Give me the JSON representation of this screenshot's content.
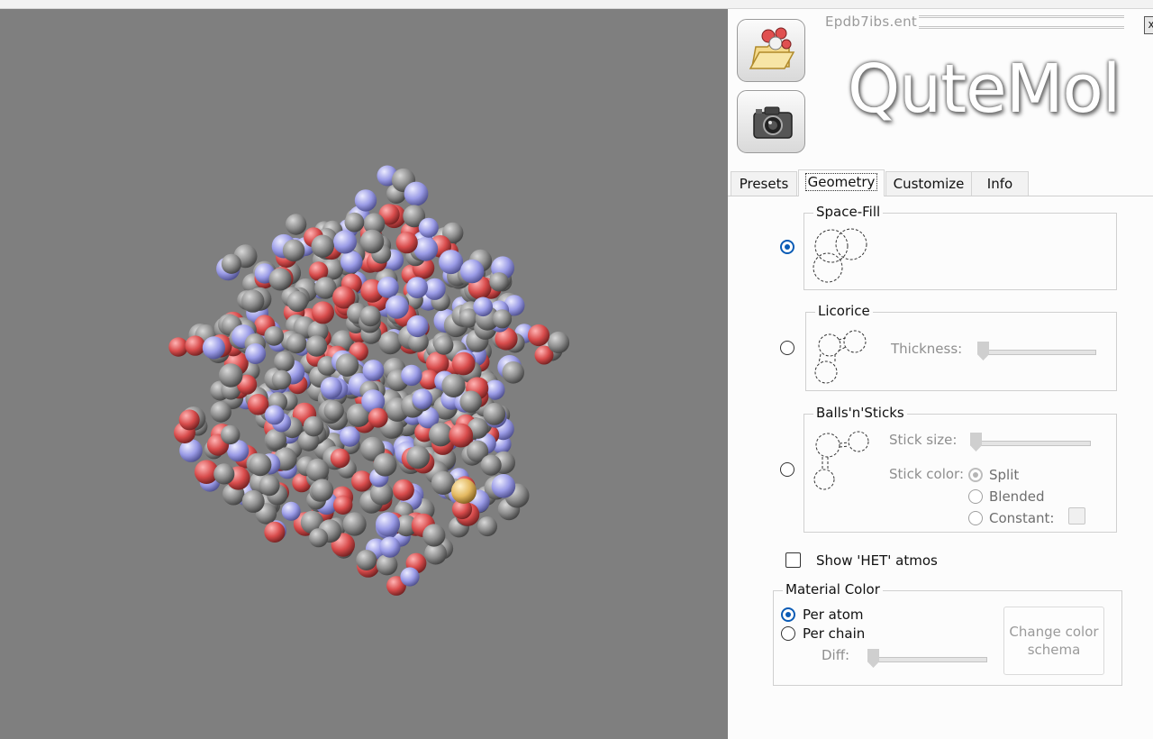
{
  "file": {
    "name": "Epdb7ibs.ent"
  },
  "app": {
    "title": "QuteMol"
  },
  "toolbar": {
    "open_icon": "open-molecule-icon",
    "snapshot_icon": "camera-icon",
    "close_symbol": "x"
  },
  "tabs": [
    {
      "label": "Presets",
      "active": false
    },
    {
      "label": "Geometry",
      "active": true
    },
    {
      "label": "Customize",
      "active": false
    },
    {
      "label": "Info",
      "active": false
    }
  ],
  "geometry": {
    "space_fill": {
      "title": "Space-Fill",
      "selected": true
    },
    "licorice": {
      "title": "Licorice",
      "selected": false,
      "thickness_label": "Thickness:"
    },
    "balls_sticks": {
      "title": "Balls'n'Sticks",
      "selected": false,
      "stick_size_label": "Stick size:",
      "stick_color_label": "Stick color:",
      "options": [
        {
          "label": "Split",
          "selected": true
        },
        {
          "label": "Blended",
          "selected": false
        },
        {
          "label": "Constant:",
          "selected": false
        }
      ]
    },
    "het_atoms": {
      "label": "Show 'HET' atmos",
      "checked": false
    }
  },
  "material": {
    "title": "Material Color",
    "options": [
      {
        "label": "Per atom",
        "selected": true
      },
      {
        "label": "Per chain",
        "selected": false
      }
    ],
    "diff_label": "Diff:",
    "change_button": "Change color schema"
  },
  "colors": {
    "viewport_bg": "#7f7f7f",
    "carbon": "#8f8f8f",
    "oxygen": "#d94f4f",
    "nitrogen": "#9a9be6",
    "sulfur": "#e3b860",
    "accent": "#0a5bb5"
  }
}
